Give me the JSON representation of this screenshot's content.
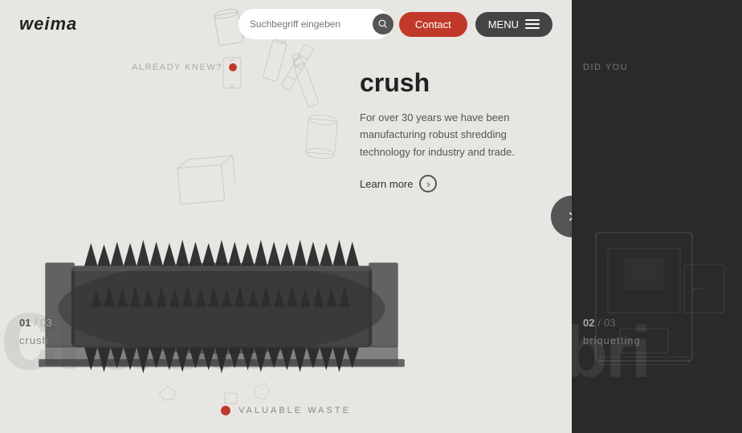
{
  "logo": {
    "text": "weima"
  },
  "header": {
    "search_placeholder": "Suchbegriff eingeben",
    "contact_label": "Contact",
    "menu_label": "MENU"
  },
  "left_panel": {
    "already_knew_label": "ALREADY KNEW?",
    "slide_current": "01",
    "slide_separator": "/",
    "slide_total": "03",
    "bg_text": "crush",
    "slide_label": "crush",
    "content": {
      "title": "crush",
      "description": "For over 30 years we have been manufacturing robust shredding technology for industry and trade.",
      "learn_more_label": "Learn more"
    },
    "bottom_label": "VALUABLE WASTE"
  },
  "right_panel": {
    "did_you_text": "DID YOU",
    "slide_current": "02",
    "slide_separator": "/",
    "slide_total": "03",
    "bg_text": "bri",
    "slide_label": "briquetting"
  }
}
